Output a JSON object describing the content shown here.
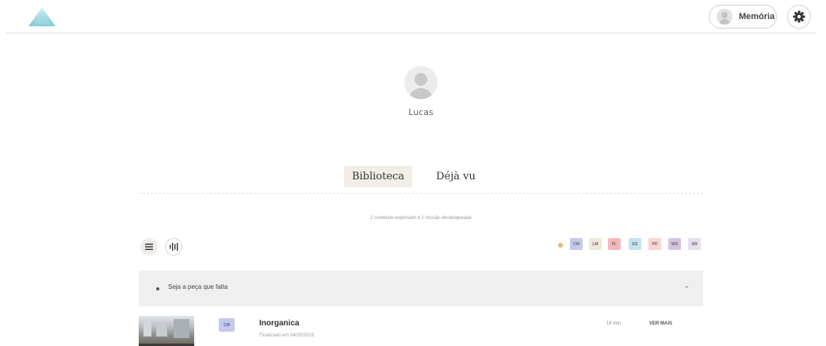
{
  "header": {
    "memoria_label": "Memória",
    "logo_icon": "triangle-logo-icon",
    "settings_icon": "gear-icon",
    "colors": {
      "logo_top": "#b6e3ea",
      "logo_bottom": "#7ccad6"
    }
  },
  "profile": {
    "name": "Lucas",
    "avatar_icon": "user-avatar-icon"
  },
  "tabs": [
    {
      "label": "Biblioteca",
      "active": true
    },
    {
      "label": "Déjà vu",
      "active": false
    }
  ],
  "summary_text": "1 conteúdo explorado e 1 missão desbloqueada",
  "view_toggles": [
    {
      "icon": "list-view-icon",
      "active": true
    },
    {
      "icon": "bars-view-icon",
      "active": false
    }
  ],
  "filter_tags": [
    {
      "code": "CM",
      "color": "#c5c8ec"
    },
    {
      "code": "LM",
      "color": "#f1e6db"
    },
    {
      "code": "PL",
      "color": "#f6b7b7"
    },
    {
      "code": "ES",
      "color": "#c6e1f2"
    },
    {
      "code": "PD",
      "color": "#f6d6cf"
    },
    {
      "code": "WS",
      "color": "#d8c3df"
    },
    {
      "code": "AR",
      "color": "#e6ddef"
    }
  ],
  "section": {
    "title": "Seja a peça que falta",
    "expand_icon": "chevron-up-icon"
  },
  "items": [
    {
      "tag": "CM",
      "tag_color": "#c5c8ec",
      "title": "Inorganica",
      "subtitle": "Finalizado em 04/25/2018",
      "duration": "16 min",
      "action": "VER MAIS"
    }
  ]
}
